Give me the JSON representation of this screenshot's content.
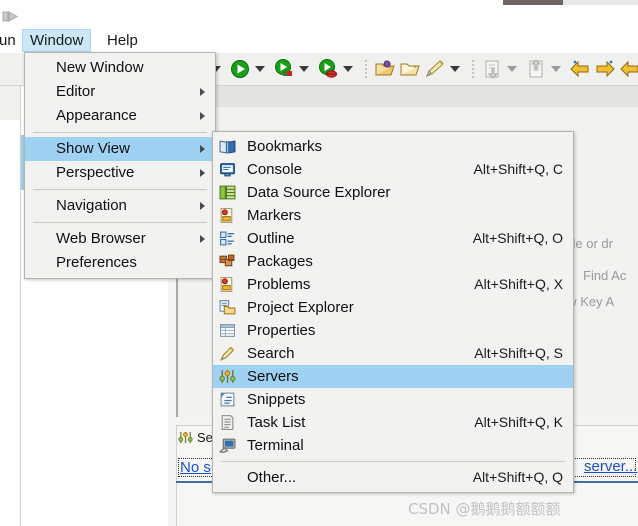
{
  "menubar": {
    "items": [
      {
        "label": "un",
        "name": "menubar-item-run",
        "state": "partial"
      },
      {
        "label": "Window",
        "name": "menubar-item-window",
        "state": "active"
      },
      {
        "label": "Help",
        "name": "menubar-item-help",
        "state": "normal"
      }
    ]
  },
  "window_menu": {
    "items": [
      {
        "label": "New Window",
        "submenu": false,
        "selected": false
      },
      {
        "label": "Editor",
        "submenu": true,
        "selected": false
      },
      {
        "label": "Appearance",
        "submenu": true,
        "selected": false
      },
      {
        "separator": true
      },
      {
        "label": "Show View",
        "submenu": true,
        "selected": true
      },
      {
        "label": "Perspective",
        "submenu": true,
        "selected": false
      },
      {
        "separator": true
      },
      {
        "label": "Navigation",
        "submenu": true,
        "selected": false
      },
      {
        "separator": true
      },
      {
        "label": "Web Browser",
        "submenu": true,
        "selected": false
      },
      {
        "label": "Preferences",
        "submenu": false,
        "selected": false
      }
    ]
  },
  "show_view_menu": {
    "items": [
      {
        "label": "Bookmarks",
        "accel": "",
        "icon": "bookmarks-icon",
        "selected": false
      },
      {
        "label": "Console",
        "accel": "Alt+Shift+Q, C",
        "icon": "console-icon",
        "selected": false
      },
      {
        "label": "Data Source Explorer",
        "accel": "",
        "icon": "data-source-explorer-icon",
        "selected": false
      },
      {
        "label": "Markers",
        "accel": "",
        "icon": "markers-icon",
        "selected": false
      },
      {
        "label": "Outline",
        "accel": "Alt+Shift+Q, O",
        "icon": "outline-icon",
        "selected": false
      },
      {
        "label": "Packages",
        "accel": "",
        "icon": "packages-icon",
        "selected": false
      },
      {
        "label": "Problems",
        "accel": "Alt+Shift+Q, X",
        "icon": "problems-icon",
        "selected": false
      },
      {
        "label": "Project Explorer",
        "accel": "",
        "icon": "project-explorer-icon",
        "selected": false
      },
      {
        "label": "Properties",
        "accel": "",
        "icon": "properties-icon",
        "selected": false
      },
      {
        "label": "Search",
        "accel": "Alt+Shift+Q, S",
        "icon": "search-icon",
        "selected": false
      },
      {
        "label": "Servers",
        "accel": "",
        "icon": "servers-icon",
        "selected": true
      },
      {
        "label": "Snippets",
        "accel": "",
        "icon": "snippets-icon",
        "selected": false
      },
      {
        "label": "Task List",
        "accel": "Alt+Shift+Q, K",
        "icon": "task-list-icon",
        "selected": false
      },
      {
        "label": "Terminal",
        "accel": "",
        "icon": "terminal-icon",
        "selected": false
      },
      {
        "separator": true
      },
      {
        "label": "Other...",
        "accel": "Alt+Shift+Q, Q",
        "icon": "",
        "selected": false
      }
    ]
  },
  "toolbar": {
    "buttons": [
      {
        "name": "debug-icon",
        "has_arrow": true,
        "dim": false
      },
      {
        "name": "run-icon",
        "has_arrow": true,
        "dim": false
      },
      {
        "name": "run-server-icon",
        "has_arrow": true,
        "dim": false
      },
      {
        "name": "stop-server-icon",
        "has_arrow": true,
        "dim": false
      },
      {
        "name": "open-folder-icon",
        "has_arrow": false,
        "dim": false
      },
      {
        "name": "open-type-icon",
        "has_arrow": false,
        "dim": false
      },
      {
        "name": "pencil-icon",
        "has_arrow": true,
        "dim": false
      },
      {
        "name": "import-icon",
        "has_arrow": true,
        "dim": true
      },
      {
        "name": "export-icon",
        "has_arrow": true,
        "dim": true
      },
      {
        "name": "back-icon",
        "has_arrow": false,
        "dim": false
      },
      {
        "name": "forward-icon",
        "has_arrow": false,
        "dim": false
      },
      {
        "name": "previous-icon",
        "has_arrow": false,
        "dim": false
      }
    ]
  },
  "editor": {
    "hints": [
      "file or dr",
      "Find Ac",
      "ow Key A"
    ]
  },
  "servers_view": {
    "tab_label": "Se",
    "empty_message_left": "No s",
    "empty_message_right": "server..."
  },
  "watermark": {
    "text": "CSDN @鹅鹅鹅额额额"
  },
  "colors": {
    "menu_bg": "#f2f2f0",
    "menu_border": "#b5b5b0",
    "highlight": "#9fd2f2",
    "menubar_highlight": "#cce8f7",
    "link": "#1a4fcf",
    "hint_text": "#9a9a9a",
    "watermark": "#c2c2c2"
  }
}
